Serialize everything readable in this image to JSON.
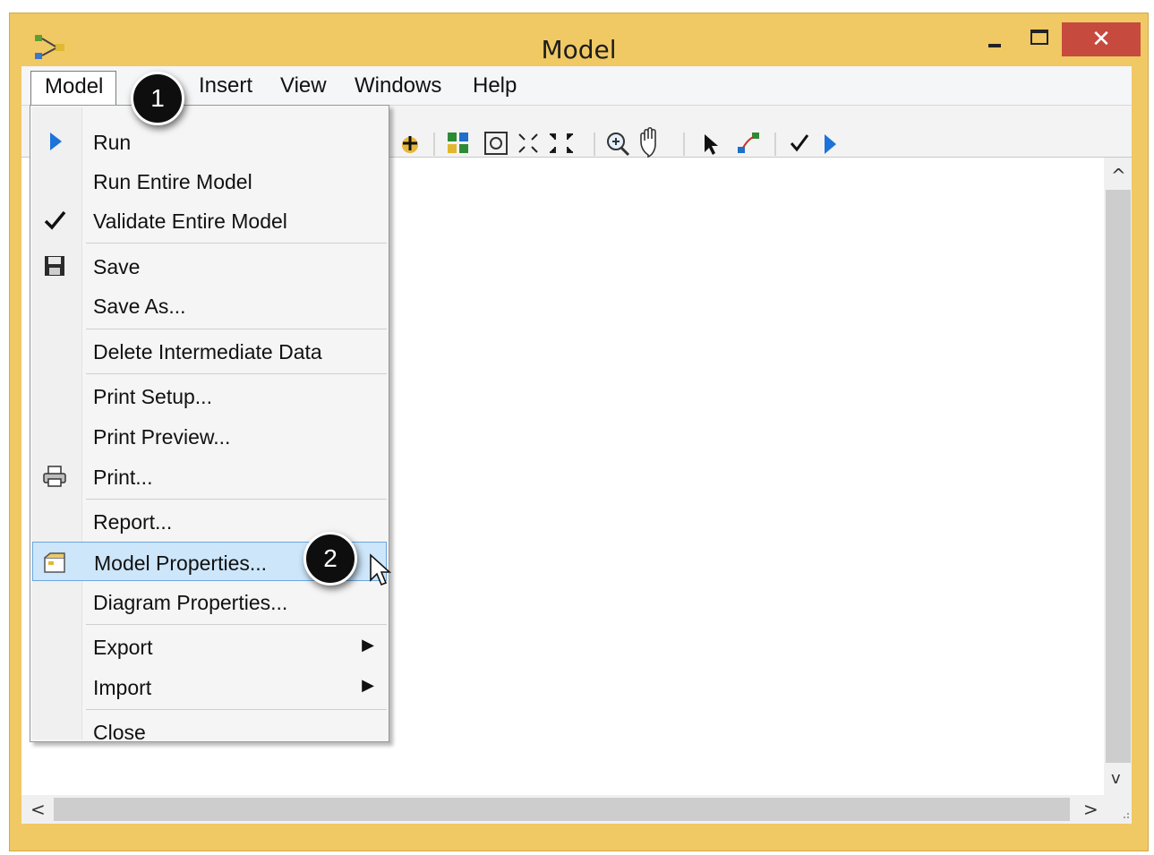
{
  "window": {
    "title": "Model",
    "close_glyph": "✕"
  },
  "menubar": {
    "items": [
      "Model",
      "Insert",
      "View",
      "Windows",
      "Help"
    ]
  },
  "model_menu": {
    "items": [
      {
        "label": "Run",
        "icon": "run-icon"
      },
      {
        "label": "Run Entire Model",
        "icon": ""
      },
      {
        "label": "Validate Entire Model",
        "icon": "checkmark-icon"
      },
      {
        "label": "Save",
        "icon": "save-icon"
      },
      {
        "label": "Save As...",
        "icon": ""
      },
      {
        "label": "Delete Intermediate Data",
        "icon": ""
      },
      {
        "label": "Print Setup...",
        "icon": ""
      },
      {
        "label": "Print Preview...",
        "icon": ""
      },
      {
        "label": "Print...",
        "icon": "print-icon"
      },
      {
        "label": "Report...",
        "icon": ""
      },
      {
        "label": "Model Properties...",
        "icon": "model-properties-icon",
        "highlighted": true
      },
      {
        "label": "Diagram Properties...",
        "icon": ""
      },
      {
        "label": "Export",
        "icon": "",
        "submenu": true
      },
      {
        "label": "Import",
        "icon": "",
        "submenu": true
      },
      {
        "label": "Close",
        "icon": ""
      }
    ]
  },
  "annotations": {
    "step1": "1",
    "step2": "2"
  },
  "colors": {
    "frame": "#f0c964",
    "close_button": "#c74a3f",
    "highlight": "#cde6fa",
    "run_blue": "#1e73d8"
  }
}
